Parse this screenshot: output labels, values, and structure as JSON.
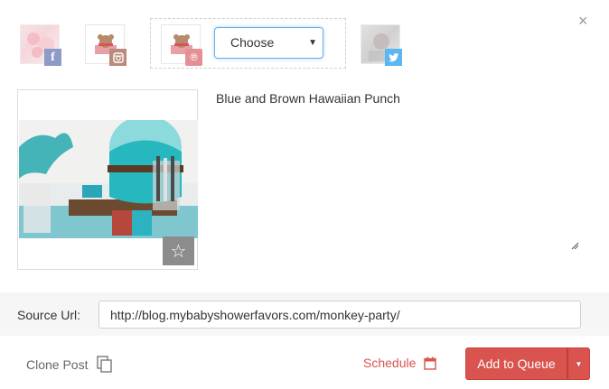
{
  "dialog": {
    "close_glyph": "×"
  },
  "accounts": [
    {
      "network": "facebook",
      "icon": "facebook-icon",
      "badge_glyph": "f",
      "badge_color": "#8e9bc7"
    },
    {
      "network": "instagram",
      "icon": "instagram-icon",
      "badge_color": "#bb8a7a"
    },
    {
      "network": "pinterest",
      "icon": "pinterest-icon",
      "badge_glyph": "℗",
      "badge_color": "#e58f95"
    },
    {
      "network": "twitter",
      "icon": "twitter-icon",
      "badge_color": "#5cb6f0"
    }
  ],
  "board_select": {
    "selected": "Choose",
    "caret_glyph": "▼"
  },
  "post": {
    "caption": "Blue and Brown Hawaiian Punch",
    "star_glyph": "☆"
  },
  "source": {
    "label": "Source Url:",
    "value": "http://blog.mybabyshowerfavors.com/monkey-party/"
  },
  "footer": {
    "clone_label": "Clone Post",
    "schedule_label": "Schedule",
    "queue_label": "Add to Queue",
    "queue_caret_glyph": "▼"
  },
  "colors": {
    "accent_red": "#d9534f",
    "focus_blue": "#66afe9",
    "twitter_blue": "#5cb6f0"
  }
}
